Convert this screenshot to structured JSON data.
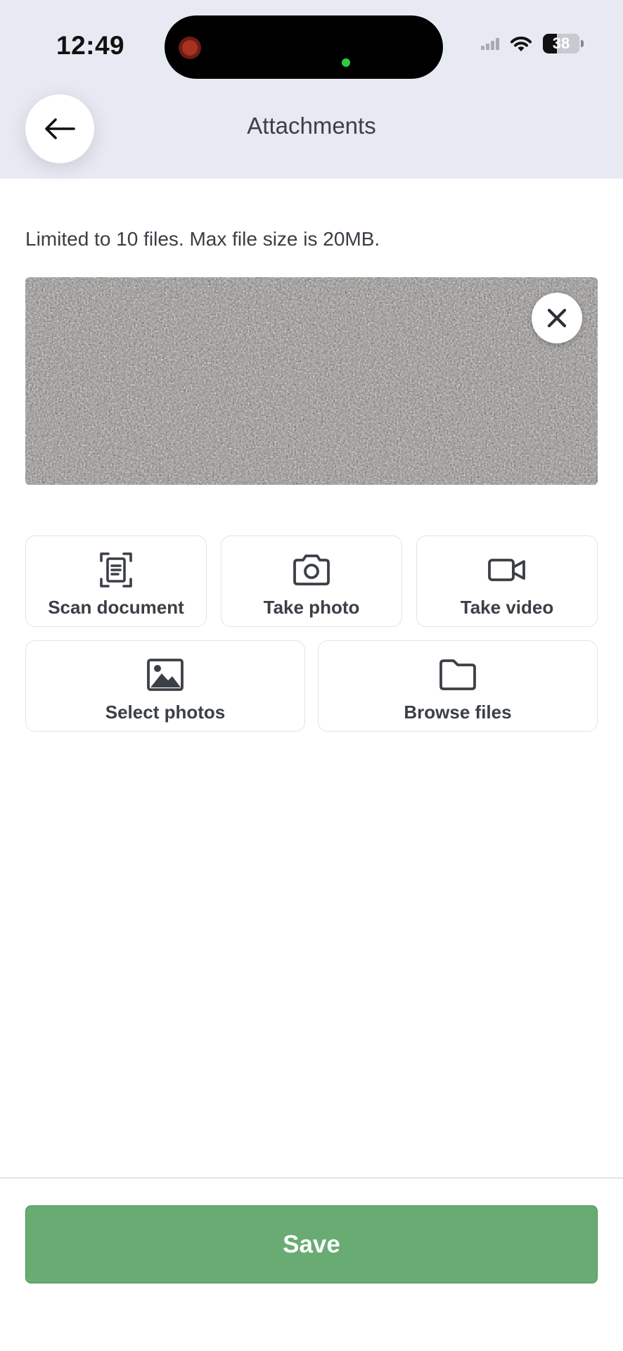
{
  "status_bar": {
    "time": "12:49",
    "battery_level": "38",
    "battery_fraction": 0.38
  },
  "header": {
    "title": "Attachments",
    "back_icon": "arrow-left-icon"
  },
  "limit_note": "Limited to 10 files. Max file size is 20MB.",
  "attachment": {
    "remove_icon": "close-icon"
  },
  "actions": [
    {
      "label": "Scan document",
      "icon": "scan-document-icon"
    },
    {
      "label": "Take photo",
      "icon": "camera-icon"
    },
    {
      "label": "Take video",
      "icon": "video-camera-icon"
    },
    {
      "label": "Select photos",
      "icon": "image-icon"
    },
    {
      "label": "Browse files",
      "icon": "folder-icon"
    }
  ],
  "footer": {
    "save_label": "Save"
  },
  "colors": {
    "header_bg": "#e8eaf3",
    "save_button": "#68ab73",
    "card_border": "#e1e3e8"
  }
}
